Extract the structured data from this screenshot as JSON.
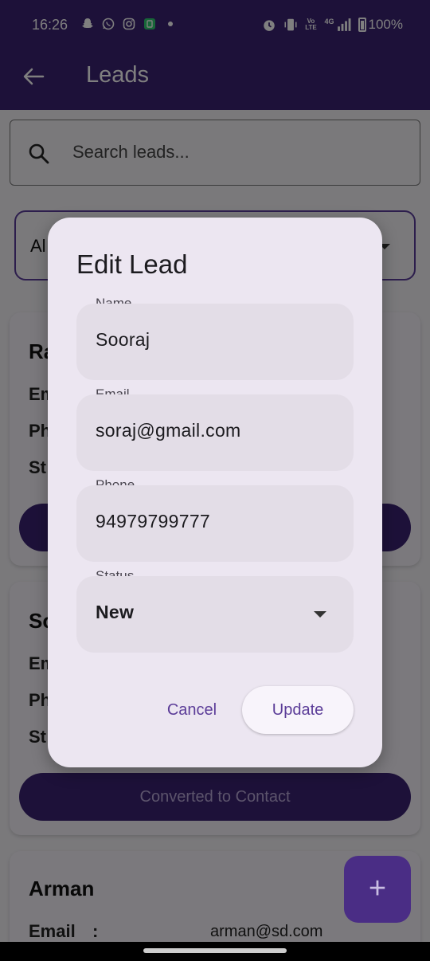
{
  "status_bar": {
    "time": "16:26",
    "battery": "100%",
    "network_volte": "Vo LTE",
    "network_4g": "4G"
  },
  "app_bar": {
    "title": "Leads"
  },
  "search": {
    "placeholder": "Search leads..."
  },
  "filter": {
    "selected": "Al"
  },
  "cards": [
    {
      "name": "Ra",
      "labels": [
        "Em",
        "Ph",
        "St"
      ],
      "button": ""
    },
    {
      "name": "So",
      "labels": [
        "Em",
        "Ph",
        "St"
      ],
      "button": "Converted to Contact"
    },
    {
      "name": "Arman",
      "email_label": "Email",
      "separator": ":",
      "email": "arman@sd.com"
    }
  ],
  "fab": {
    "icon": "+"
  },
  "dialog": {
    "title": "Edit Lead",
    "fields": {
      "name_label": "Name",
      "name_value": "Sooraj",
      "email_label": "Email",
      "email_value": "soraj@gmail.com",
      "phone_label": "Phone",
      "phone_value": "94979799777",
      "status_label": "Status",
      "status_value": "New"
    },
    "cancel_label": "Cancel",
    "update_label": "Update"
  },
  "colors": {
    "primary": "#3b2272",
    "accent": "#5b3c98",
    "dialog_bg": "#ece6f1",
    "field_bg": "#e3dde7"
  }
}
